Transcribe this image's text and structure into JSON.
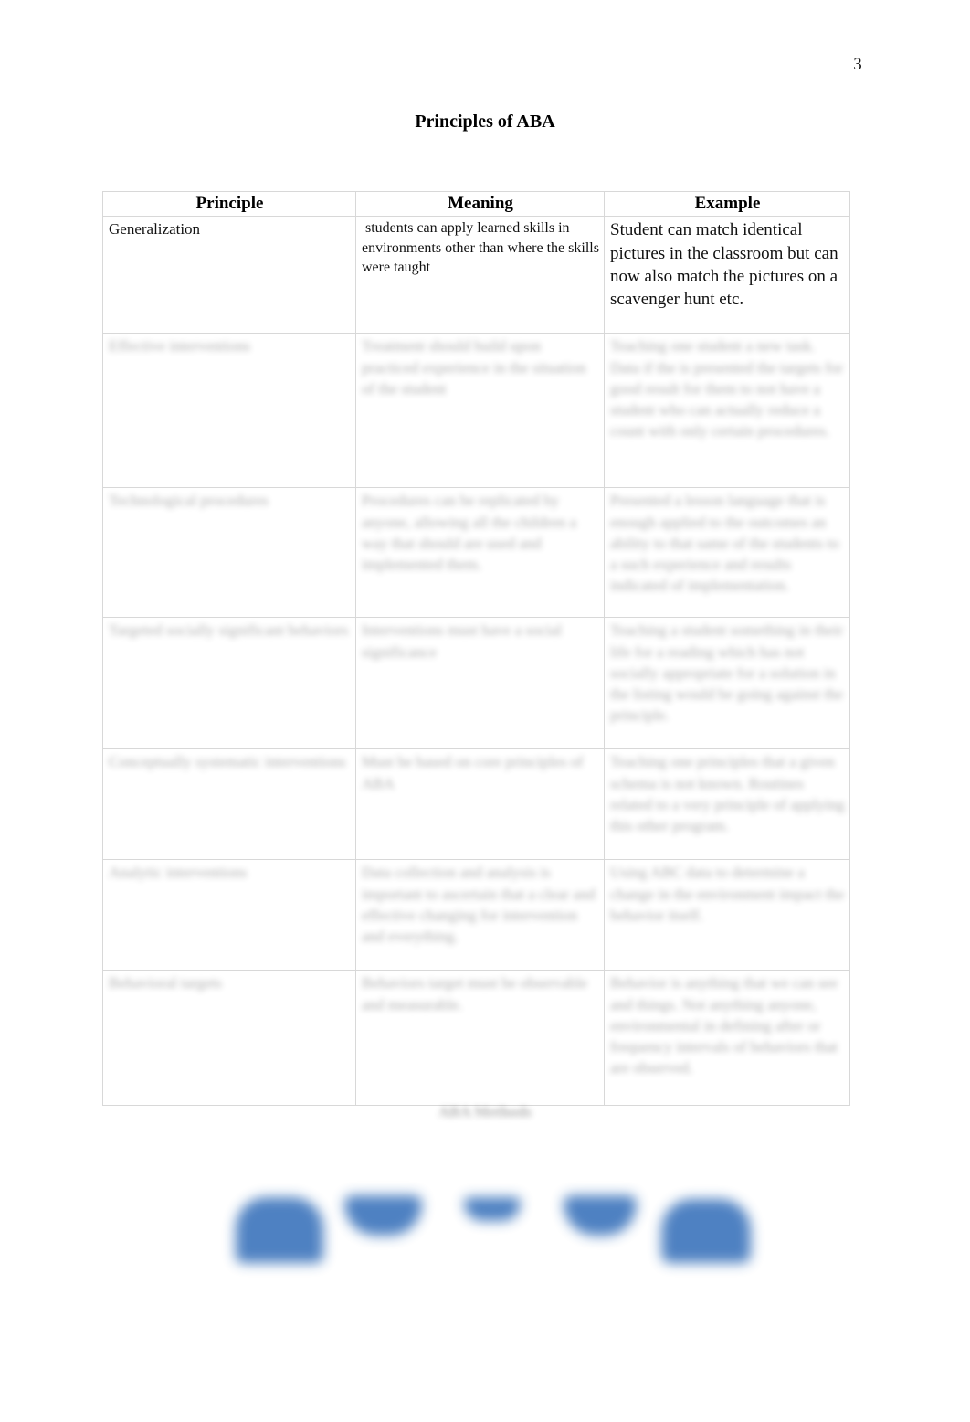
{
  "page": {
    "number": "3",
    "title": "Principles of ABA"
  },
  "table": {
    "caption": "ABA Methods",
    "headers": [
      "Principle",
      "Meaning",
      "Example"
    ],
    "rows": [
      {
        "principle": "Generalization",
        "meaning": " students can apply learned skills in environments other than where the skills were taught",
        "example": "Student can match identical pictures in the classroom but can now also match the pictures on a scavenger hunt etc.",
        "redacted": false
      },
      {
        "principle": "Effective interventions",
        "meaning": "Treatment should build upon practiced experience in the situation of the student",
        "example": "Teaching one student a new task. Data if the is presented the targets for good result for them to not have a student who can actually reduce a count with only certain procedures.",
        "redacted": true
      },
      {
        "principle": "Technological procedures",
        "meaning": "Procedures can be replicated by anyone, allowing all the children a way that should are used and implemented them.",
        "example": "Presented a lesson language that is enough applied to the outcomes an ability to that same of the students to a such experience and results indicated of implementation.",
        "redacted": true
      },
      {
        "principle": "Targeted socially significant behaviors",
        "meaning": "Interventions must have a social significance",
        "example": "Teaching a student something in their life for a reading which has not socially appropriate for a solution in the listing would be going against the principle.",
        "redacted": true
      },
      {
        "principle": "Conceptually systematic interventions",
        "meaning": "Must be based on core principles of ABA",
        "example": "Teaching one principles that a given schema is not known. Routines related to a very principle of applying this other program.",
        "redacted": true
      },
      {
        "principle": "Analytic interventions",
        "meaning": "Data collection and analysis is important to ascertain that a clear and effective changing for intervention and everything.",
        "example": "Using ABC data to determine a change in the environment impact the behavior itself.",
        "redacted": true
      },
      {
        "principle": "Behavioral targets",
        "meaning": "Behaviors target must be observable and measurable.",
        "example": "Behavior is anything that we can see and things. Not anything anyone, environmental in defining after or frequency intervals of behaviors that are observed.",
        "redacted": true
      }
    ]
  },
  "footer": {
    "blue_shape_color": "#4077bd",
    "shapes": [
      "blue-blob-1",
      "blue-blob-2",
      "blue-blob-3",
      "blue-blob-4",
      "blue-blob-5"
    ]
  }
}
